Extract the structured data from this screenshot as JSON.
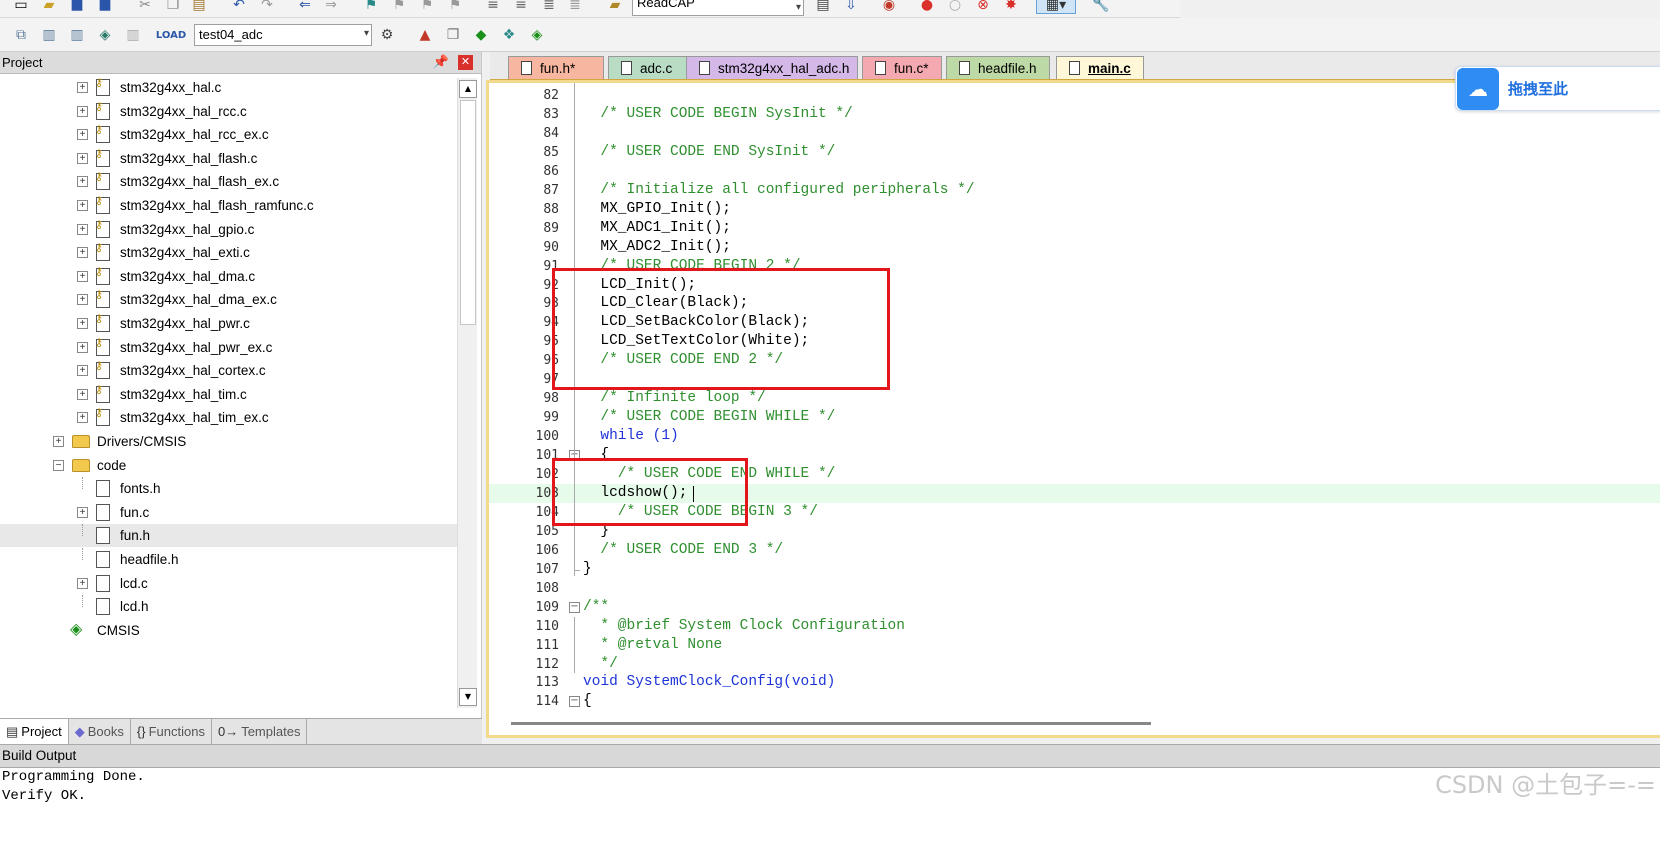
{
  "toolbar": {
    "target_select_value": "test04_adc",
    "find_select_value": "ReadCAP"
  },
  "project_pane": {
    "title": "Project",
    "tree": [
      {
        "label": "stm32g4xx_hal.c",
        "kind": "file-key",
        "expander": "+"
      },
      {
        "label": "stm32g4xx_hal_rcc.c",
        "kind": "file-key",
        "expander": "+"
      },
      {
        "label": "stm32g4xx_hal_rcc_ex.c",
        "kind": "file-key",
        "expander": "+"
      },
      {
        "label": "stm32g4xx_hal_flash.c",
        "kind": "file-key",
        "expander": "+"
      },
      {
        "label": "stm32g4xx_hal_flash_ex.c",
        "kind": "file-key",
        "expander": "+"
      },
      {
        "label": "stm32g4xx_hal_flash_ramfunc.c",
        "kind": "file-key",
        "expander": "+"
      },
      {
        "label": "stm32g4xx_hal_gpio.c",
        "kind": "file-key",
        "expander": "+"
      },
      {
        "label": "stm32g4xx_hal_exti.c",
        "kind": "file-key",
        "expander": "+"
      },
      {
        "label": "stm32g4xx_hal_dma.c",
        "kind": "file-key",
        "expander": "+"
      },
      {
        "label": "stm32g4xx_hal_dma_ex.c",
        "kind": "file-key",
        "expander": "+"
      },
      {
        "label": "stm32g4xx_hal_pwr.c",
        "kind": "file-key",
        "expander": "+"
      },
      {
        "label": "stm32g4xx_hal_pwr_ex.c",
        "kind": "file-key",
        "expander": "+"
      },
      {
        "label": "stm32g4xx_hal_cortex.c",
        "kind": "file-key",
        "expander": "+"
      },
      {
        "label": "stm32g4xx_hal_tim.c",
        "kind": "file-key",
        "expander": "+"
      },
      {
        "label": "stm32g4xx_hal_tim_ex.c",
        "kind": "file-key",
        "expander": "+"
      },
      {
        "label": "Drivers/CMSIS",
        "kind": "folder",
        "expander": "+"
      },
      {
        "label": "code",
        "kind": "folder-open",
        "expander": "−"
      },
      {
        "label": "fonts.h",
        "kind": "file",
        "expander": ""
      },
      {
        "label": "fun.c",
        "kind": "file",
        "expander": "+"
      },
      {
        "label": "fun.h",
        "kind": "file",
        "expander": "",
        "selected": true
      },
      {
        "label": "headfile.h",
        "kind": "file",
        "expander": ""
      },
      {
        "label": "lcd.c",
        "kind": "file",
        "expander": "+"
      },
      {
        "label": "lcd.h",
        "kind": "file",
        "expander": ""
      },
      {
        "label": "CMSIS",
        "kind": "cmsis",
        "expander": ""
      }
    ],
    "tabs": [
      {
        "label": "Project",
        "icon": "project-icon",
        "active": true
      },
      {
        "label": "Books",
        "icon": "books-icon",
        "active": false
      },
      {
        "label": "Functions",
        "icon": "braces-icon",
        "active": false
      },
      {
        "label": "Templates",
        "icon": "templates-icon",
        "active": false
      }
    ]
  },
  "editor_tabs": [
    {
      "label": "fun.h*",
      "color": "#f7b6a0",
      "icon": "doc-icon"
    },
    {
      "label": "adc.c",
      "color": "#b9dcc4",
      "icon": "gear-doc-icon"
    },
    {
      "label": "stm32g4xx_hal_adc.h",
      "color": "#d4b8e8",
      "icon": "key-doc-icon"
    },
    {
      "label": "fun.c*",
      "color": "#f4a8b0",
      "icon": "doc-icon"
    },
    {
      "label": "headfile.h",
      "color": "#bcd9a6",
      "icon": "doc-icon"
    },
    {
      "label": "main.c",
      "color": "#fff8d8",
      "icon": "doc-icon",
      "active": true
    }
  ],
  "code_lines": [
    {
      "n": "82",
      "text": ""
    },
    {
      "n": "83",
      "text": "  /* USER CODE BEGIN SysInit */",
      "style": "cmt"
    },
    {
      "n": "84",
      "text": ""
    },
    {
      "n": "85",
      "text": "  /* USER CODE END SysInit */",
      "style": "cmt"
    },
    {
      "n": "86",
      "text": ""
    },
    {
      "n": "87",
      "text": "  /* Initialize all configured peripherals */",
      "style": "cmt"
    },
    {
      "n": "88",
      "text": "  MX_GPIO_Init();"
    },
    {
      "n": "89",
      "text": "  MX_ADC1_Init();"
    },
    {
      "n": "90",
      "text": "  MX_ADC2_Init();"
    },
    {
      "n": "91",
      "text": "  /* USER CODE BEGIN 2 */",
      "style": "cmt"
    },
    {
      "n": "92",
      "text": "  LCD_Init();"
    },
    {
      "n": "93",
      "text": "  LCD_Clear(Black);"
    },
    {
      "n": "94",
      "text": "  LCD_SetBackColor(Black);"
    },
    {
      "n": "95",
      "text": "  LCD_SetTextColor(White);"
    },
    {
      "n": "96",
      "text": "  /* USER CODE END 2 */",
      "style": "cmt"
    },
    {
      "n": "97",
      "text": ""
    },
    {
      "n": "98",
      "text": "  /* Infinite loop */",
      "style": "cmt"
    },
    {
      "n": "99",
      "text": "  /* USER CODE BEGIN WHILE */",
      "style": "cmt"
    },
    {
      "n": "100",
      "text": "  while (1)",
      "style": "while"
    },
    {
      "n": "101",
      "text": "  {"
    },
    {
      "n": "102",
      "text": "    /* USER CODE END WHILE */",
      "style": "cmt"
    },
    {
      "n": "103",
      "text": "  lcdshow();",
      "current": true
    },
    {
      "n": "104",
      "text": "    /* USER CODE BEGIN 3 */",
      "style": "cmt"
    },
    {
      "n": "105",
      "text": "  }"
    },
    {
      "n": "106",
      "text": "  /* USER CODE END 3 */",
      "style": "cmt"
    },
    {
      "n": "107",
      "text": "}"
    },
    {
      "n": "108",
      "text": ""
    },
    {
      "n": "109",
      "text": "/**",
      "style": "cmt"
    },
    {
      "n": "110",
      "text": "  * @brief System Clock Configuration",
      "style": "cmt"
    },
    {
      "n": "111",
      "text": "  * @retval None",
      "style": "cmt"
    },
    {
      "n": "112",
      "text": "  */",
      "style": "cmt"
    },
    {
      "n": "113",
      "text": "void SystemClock_Config(void)",
      "style": "void"
    },
    {
      "n": "114",
      "text": "{"
    }
  ],
  "baidu_widget": {
    "label": "拖拽至此"
  },
  "build_output": {
    "title": "Build Output",
    "lines": [
      "Programming Done.",
      "Verify OK."
    ]
  },
  "watermark": "CSDN @土包子=-=",
  "colors": {
    "annotation_red": "#e3161b",
    "comment_green": "#2f8f2f",
    "keyword_blue": "#1e34d8"
  }
}
